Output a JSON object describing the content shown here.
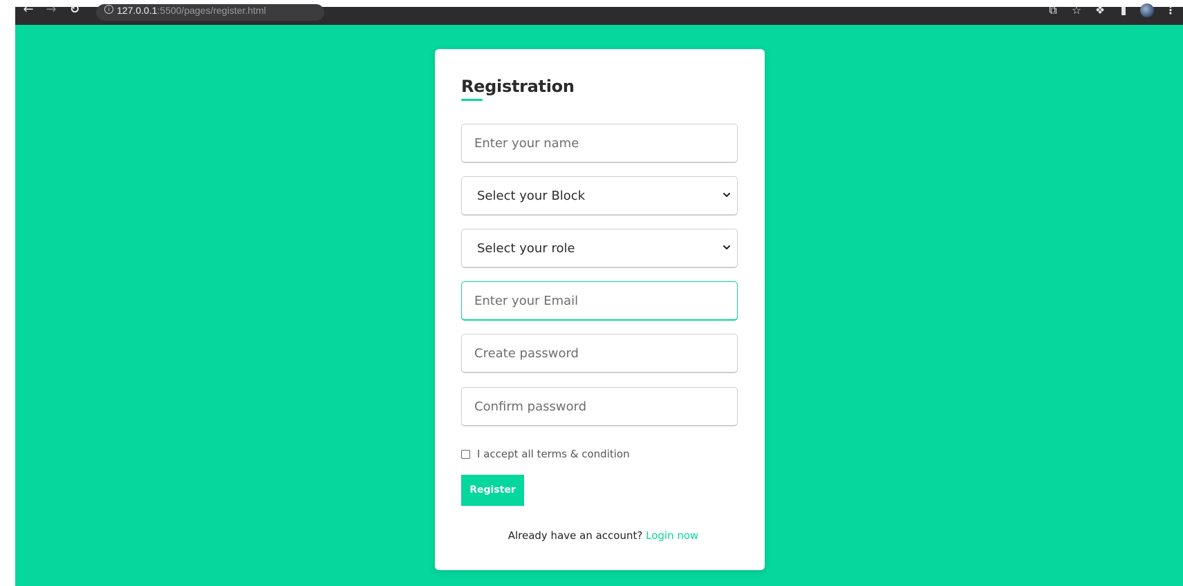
{
  "browser": {
    "url_host": "127.0.0.1",
    "url_rest": ":5500/pages/register.html",
    "icons": [
      "back-arrow-icon",
      "forward-arrow-icon",
      "reload-icon",
      "info-icon",
      "share-icon",
      "star-icon",
      "extensions-icon",
      "sidebar-icon",
      "avatar",
      "menu-icon"
    ]
  },
  "colors": {
    "accent": "#06d79d",
    "background": "#06d79d",
    "card": "#ffffff"
  },
  "form": {
    "title": "Registration",
    "name_placeholder": "Enter your name",
    "block_select": "Select your Block",
    "role_select": "Select your role",
    "email_placeholder": "Enter your Email",
    "password_placeholder": "Create password",
    "confirm_placeholder": "Confirm password",
    "terms_label": "I accept all terms & condition",
    "register_label": "Register",
    "login_prompt": "Already have an account?",
    "login_link": "Login now"
  }
}
